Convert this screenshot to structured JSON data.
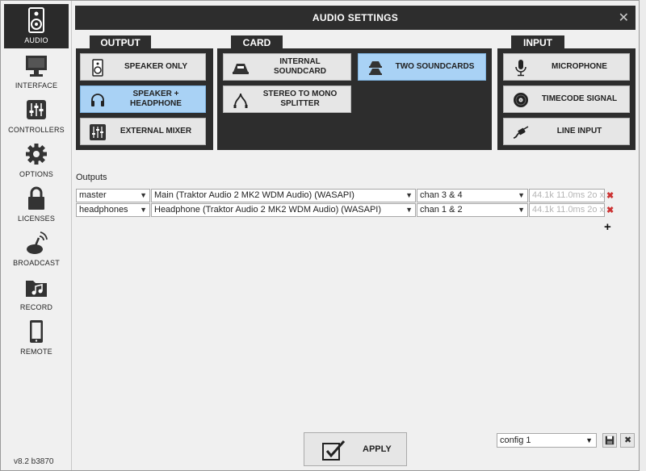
{
  "window": {
    "title": "AUDIO SETTINGS",
    "close": "✕"
  },
  "sidebar": {
    "items": [
      {
        "label": "AUDIO",
        "icon": "speaker-icon"
      },
      {
        "label": "INTERFACE",
        "icon": "monitor-icon"
      },
      {
        "label": "CONTROLLERS",
        "icon": "sliders-icon"
      },
      {
        "label": "OPTIONS",
        "icon": "gear-icon"
      },
      {
        "label": "LICENSES",
        "icon": "lock-icon"
      },
      {
        "label": "BROADCAST",
        "icon": "broadcast-icon"
      },
      {
        "label": "RECORD",
        "icon": "music-folder-icon"
      },
      {
        "label": "REMOTE",
        "icon": "phone-icon"
      }
    ],
    "version": "v8.2 b3870"
  },
  "sections": {
    "output": {
      "title": "OUTPUT",
      "options": [
        {
          "label": "SPEAKER ONLY",
          "selected": false
        },
        {
          "label": "SPEAKER + HEADPHONE",
          "selected": true
        },
        {
          "label": "EXTERNAL MIXER",
          "selected": false
        }
      ]
    },
    "card": {
      "title": "CARD",
      "options": [
        {
          "label": "INTERNAL SOUNDCARD",
          "selected": false
        },
        {
          "label": "TWO SOUNDCARDS",
          "selected": true
        },
        {
          "label": "STEREO TO MONO SPLITTER",
          "selected": false
        }
      ]
    },
    "input": {
      "title": "INPUT",
      "options": [
        {
          "label": "MICROPHONE",
          "selected": false
        },
        {
          "label": "TIMECODE SIGNAL",
          "selected": false
        },
        {
          "label": "LINE INPUT",
          "selected": false
        }
      ]
    }
  },
  "outputs": {
    "label": "Outputs",
    "rows": [
      {
        "name": "master",
        "device": "Main (Traktor Audio 2 MK2 WDM Audio) (WASAPI)",
        "channels": "chan 3 & 4",
        "info": "44.1k 11.0ms 2o x"
      },
      {
        "name": "headphones",
        "device": "Headphone (Traktor Audio 2 MK2 WDM Audio) (WASAPI)",
        "channels": "chan 1 & 2",
        "info": "44.1k 11.0ms 2o x"
      }
    ],
    "delete_glyph": "✖",
    "add_glyph": "+"
  },
  "footer": {
    "apply_label": "APPLY",
    "config_value": "config 1"
  },
  "colors": {
    "dark_panel": "#2d2d2d",
    "selected": "#a9d2f5",
    "button": "#e6e6e6",
    "delete": "#cc3333"
  }
}
